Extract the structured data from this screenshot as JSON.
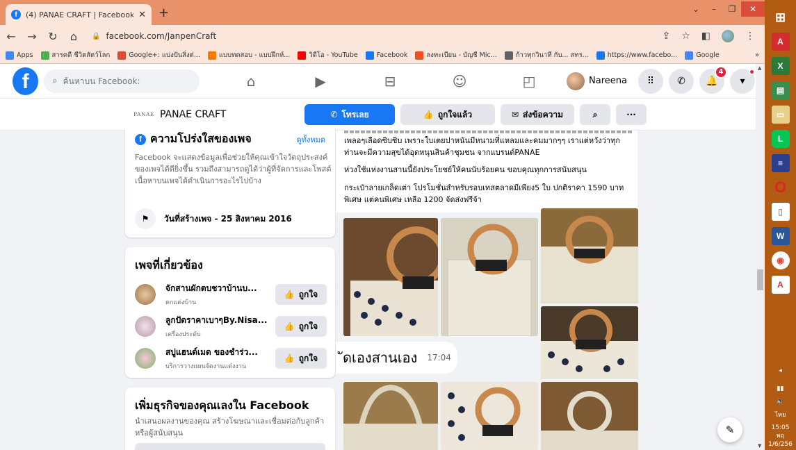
{
  "browser": {
    "tab_title": "(4) PANAE CRAFT | Facebook",
    "new_tab": "+",
    "url": "facebook.com/JanpenCraft",
    "bookmarks": [
      {
        "label": "Apps",
        "icon": "apps-grid-icon",
        "color": "#4285f4"
      },
      {
        "label": "สารคดี ชีวิตสัตว์โลก",
        "icon": "leaf-icon",
        "color": "#4caf50"
      },
      {
        "label": "Google+: แบ่งปันสิ่งต่...",
        "icon": "google-plus-icon",
        "color": "#dd4b39"
      },
      {
        "label": "แบบทดสอบ - แบบฝึกห์...",
        "icon": "blogger-icon",
        "color": "#f57c00"
      },
      {
        "label": "วิดีโอ - YouTube",
        "icon": "youtube-icon",
        "color": "#ff0000"
      },
      {
        "label": "Facebook",
        "icon": "facebook-icon",
        "color": "#1877f2"
      },
      {
        "label": "ลงทะเบียน - บัญชี Mic...",
        "icon": "microsoft-icon",
        "color": "#f25022"
      },
      {
        "label": "ก้าวทุกวินาที กับ... สทร...",
        "icon": "globe-icon",
        "color": "#5f6368"
      },
      {
        "label": "https://www.facebo...",
        "icon": "facebook-icon",
        "color": "#1877f2"
      },
      {
        "label": "Google",
        "icon": "google-icon",
        "color": "#4285f4"
      }
    ],
    "bookmarks_more": "»"
  },
  "fb": {
    "logo": "f",
    "search_placeholder": "ค้นหาบน Facebook:",
    "profile_name": "Nareena",
    "notification_count": "4"
  },
  "page": {
    "logo_text": "PANAE",
    "name": "PANAE CRAFT",
    "call_button": "โทรเลย",
    "liked_button": "ถูกใจแล้ว",
    "message_button": "ส่งข้อความ",
    "more_button": "···"
  },
  "transparency": {
    "title": "ความโปร่งใสของเพจ",
    "see_all": "ดูทั้งหมด",
    "text": "Facebook จะแสดงข้อมูลเพื่อช่วยให้คุณเข้าใจวัตถุประสงค์ของเพจได้ดียิ่งขึ้น รวมถึงสามารถดูได้ว่าผู้ที่จัดการและโพสต์เนื้อหาบนเพจได้ดำเนินการอะไรไปบ้าง",
    "created": "วันที่สร้างเพจ - 25 สิงหาคม 2016"
  },
  "related": {
    "title": "เพจที่เกี่ยวข้อง",
    "like_label": "ถูกใจ",
    "items": [
      {
        "name": "จักสานผักตบชวาบ้านบ...",
        "category": "ตกแต่งบ้าน"
      },
      {
        "name": "ลูกปัดราคาเบาๆBy.Nisa...",
        "category": "เครื่องประดับ"
      },
      {
        "name": "สบู่แฮนด์เมด ของชำร่ว...",
        "category": "บริการวางแผนจัดงานแต่งงาน"
      }
    ]
  },
  "grow": {
    "title": "เพิ่มธุรกิจของคุณเลงใน Facebook",
    "text": "นำเสนอผลงานของคุณ สร้างโฆษณาและเชื่อมต่อกับลูกค้าหรือผู้สนับสนุน"
  },
  "post": {
    "line1": "เพลอๆเลือดซิบซิบ เพราะใบเตยปาหนันมีหนามที่แหลมและคมมากๆๆ เราแต่หวังว่าทุกท่านจะมีความสุขได้อุดหนุนสินค้าชุมชน จากแบรนด์PANAE",
    "line2": "ห่วงใช้แห่งงานสานนี้ยังประโยชย์ให้คนนับร้อยคน ขอบคุณทุกการสนับสนุน",
    "line3": "กระเป๋าลายเกล็ดเต่า โปรโมชั่นสำหรับรอบเทสตลาดมีเพียง5 ใบ ปกติราคา 1590 บาท พิเศษ แต่คนพิเศษ เหลือ 1200 จัดส่งฟรีจ้า"
  },
  "message": {
    "text": "ัดเองสานเอง",
    "time": "17:04"
  },
  "tray": {
    "lang": "ไทย",
    "time": "15:05",
    "day": "พฤ",
    "date": "1/6/256"
  },
  "colors": {
    "fb_blue": "#1877f2",
    "tab_strip": "#e9926a",
    "toolbar": "#fbe6dc",
    "taskbar": "#b15b13",
    "notification_red": "#e41e3f"
  }
}
